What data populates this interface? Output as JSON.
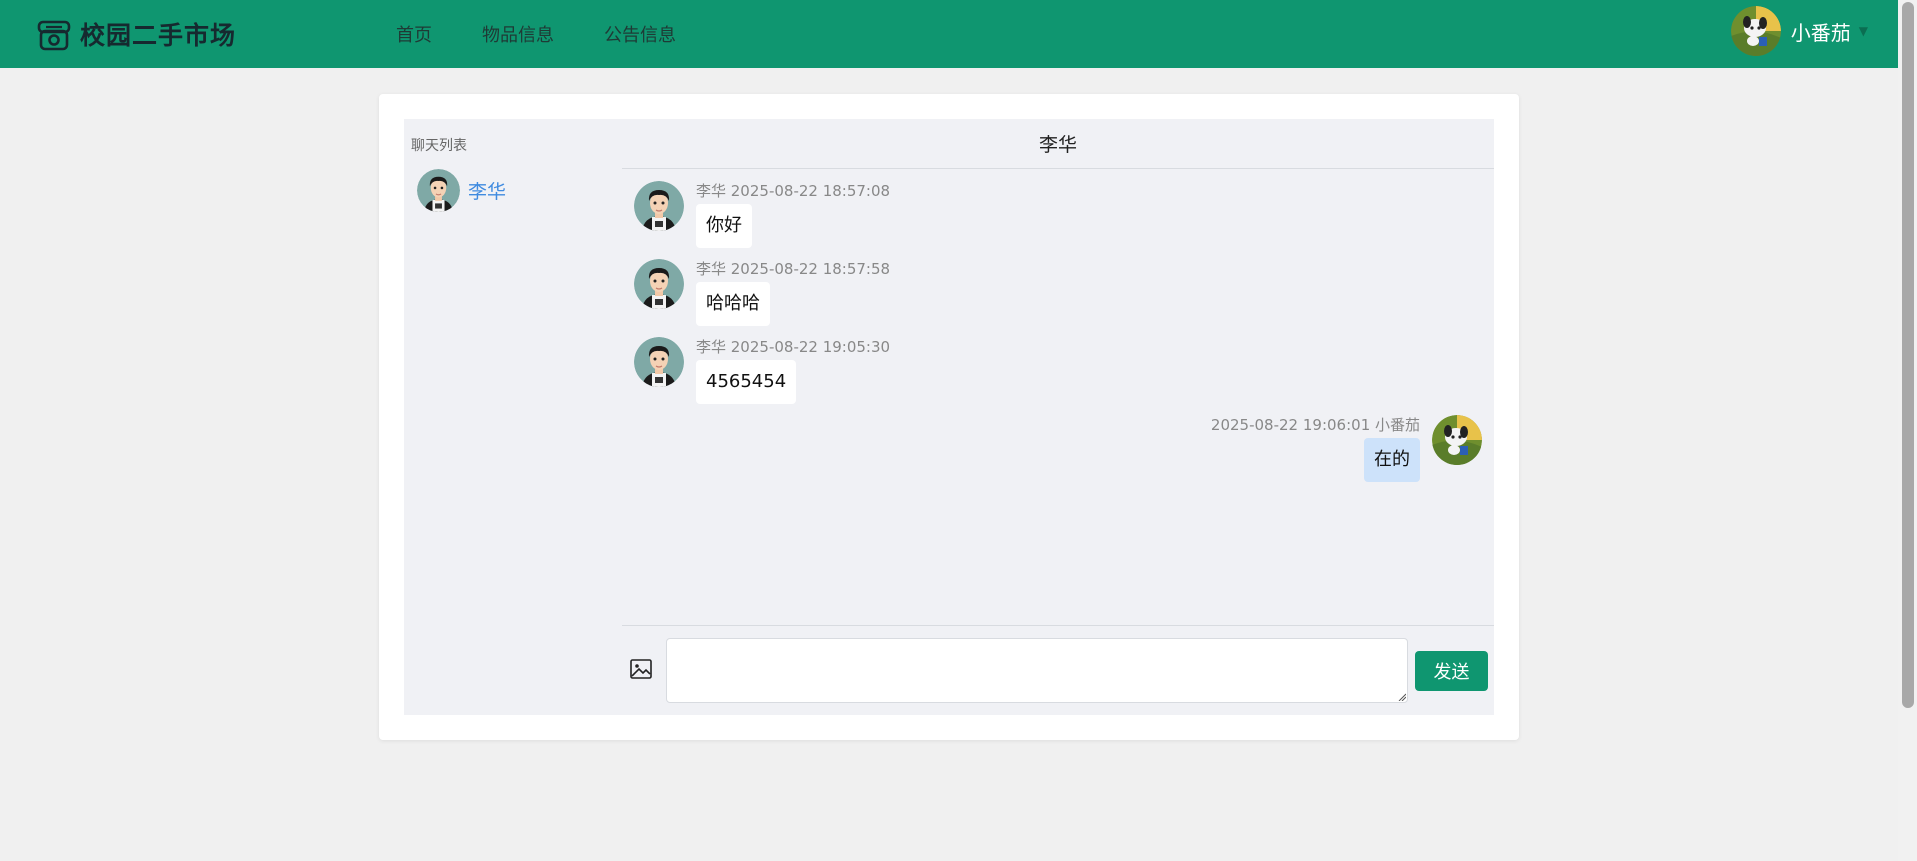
{
  "header": {
    "brand_title": "校园二手市场",
    "nav": [
      "首页",
      "物品信息",
      "公告信息"
    ],
    "user_name": "小番茄"
  },
  "sidebar": {
    "title": "聊天列表",
    "contacts": [
      {
        "name": "李华"
      }
    ]
  },
  "chat": {
    "title": "李华",
    "messages": [
      {
        "side": "left",
        "meta": "李华 2025-08-22 18:57:08",
        "text": "你好"
      },
      {
        "side": "left",
        "meta": "李华 2025-08-22 18:57:58",
        "text": "哈哈哈"
      },
      {
        "side": "left",
        "meta": "李华 2025-08-22 19:05:30",
        "text": "4565454"
      },
      {
        "side": "right",
        "meta": "2025-08-22 19:06:01 小番茄",
        "text": "在的"
      }
    ],
    "input_value": "",
    "send_label": "发送"
  },
  "colors": {
    "primary": "#0f9670",
    "link": "#3f8be0",
    "panel": "#f0f1f5",
    "my_bubble": "#cde2fa"
  }
}
